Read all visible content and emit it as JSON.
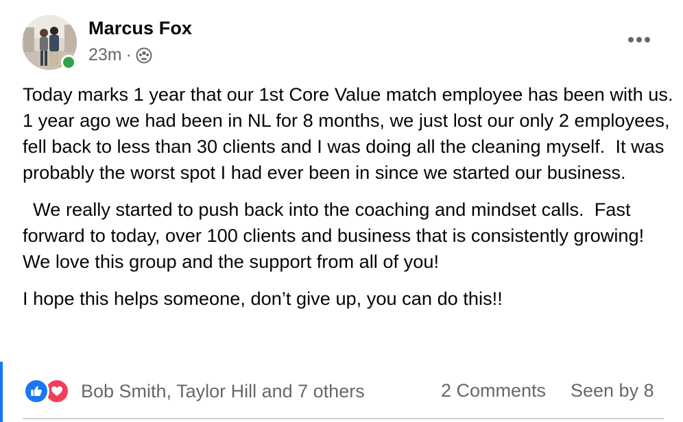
{
  "post": {
    "author": "Marcus Fox",
    "timestamp": "23m",
    "separator": "·",
    "audience_icon": "group-icon",
    "more_icon": "more-horizontal-icon",
    "paragraphs": [
      "Today marks 1 year that our 1st Core Value match employee has been with us.   1 year ago we had been in NL for 8 months, we just lost our only 2 employees, fell back to less than 30 clients and I was doing all the cleaning myself.  It was probably the worst spot I had ever been in since we started our business.",
      "  We really started to push back into the coaching and mindset calls.  Fast forward to today, over 100 clients and business that is consistently growing! We love this group and the support from all of you!",
      "I hope this helps someone, don’t give up, you can do this!!"
    ]
  },
  "footer": {
    "reaction_icons": [
      "like-icon",
      "love-icon"
    ],
    "reactors": "Bob Smith, Taylor Hill and 7 others",
    "comments": "2 Comments",
    "seen_by": "Seen by 8"
  },
  "colors": {
    "accent": "#1877f2",
    "online": "#31a24c",
    "love": "#f33e58",
    "secondary_text": "#65676b"
  }
}
